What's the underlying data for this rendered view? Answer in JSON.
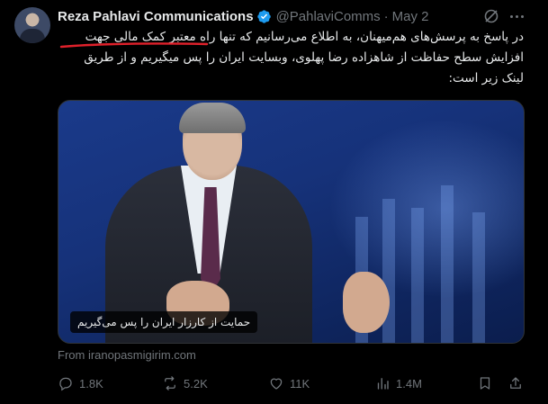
{
  "author": {
    "name": "Reza Pahlavi Communications",
    "handle": "@PahlaviComms",
    "separator": "·",
    "date": "May 2",
    "avatar_icon": "avatar-photo",
    "verified_icon": "verified-badge-icon"
  },
  "tweet": {
    "line1": "در پاسخ به پرسش‌های هم‌میهنان، به اطلاع می‌رسانیم که تنها راه معتبر کمک مالی جهت",
    "line2": "افزایش سطح حفاظت از شاهزاده رضا پهلوی، وبسایت ایران را پس میگیریم و از طریق",
    "line3": "لینک زیر است:"
  },
  "media": {
    "caption": "حمایت از کارزار ایران را پس می‌گیریم"
  },
  "link": {
    "from": "From iranopasmigirim.com"
  },
  "actions": {
    "replies": "1.8K",
    "reposts": "5.2K",
    "likes": "11K",
    "views": "1.4M"
  },
  "colors": {
    "accent": "#1d9bf0",
    "muted": "#71767b",
    "underline": "#e0212b"
  }
}
